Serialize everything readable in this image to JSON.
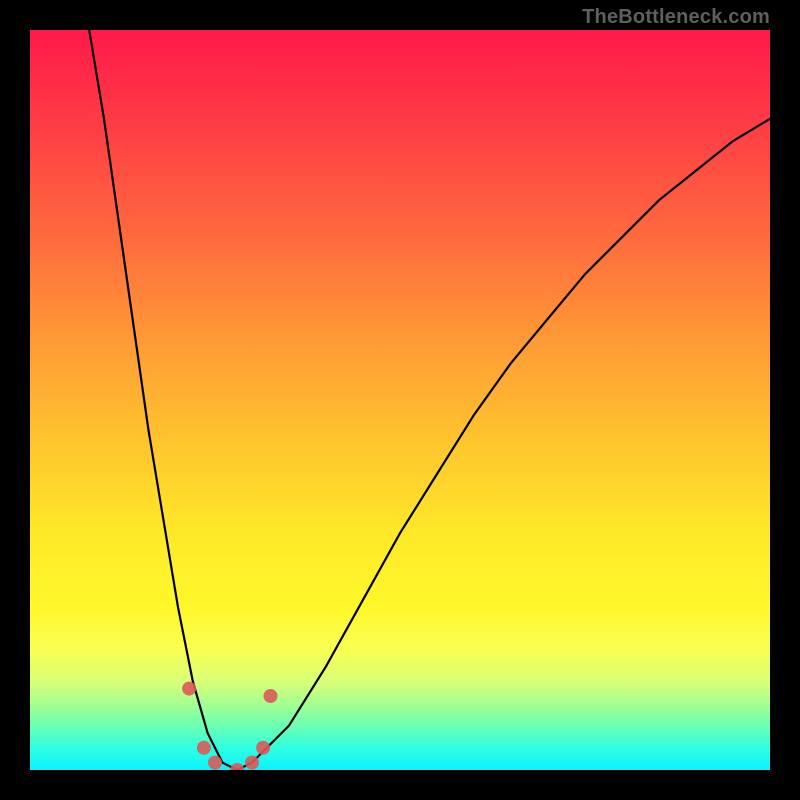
{
  "watermark": "TheBottleneck.com",
  "chart_data": {
    "type": "line",
    "title": "",
    "xlabel": "",
    "ylabel": "",
    "xlim": [
      0,
      100
    ],
    "ylim": [
      0,
      100
    ],
    "gradient_stops": [
      {
        "pos": 0,
        "color": "#ff1a4a"
      },
      {
        "pos": 50,
        "color": "#ffca30"
      },
      {
        "pos": 80,
        "color": "#fff82a"
      },
      {
        "pos": 100,
        "color": "#08f3ff"
      }
    ],
    "series": [
      {
        "name": "bottleneck-curve",
        "x": [
          8,
          10,
          12,
          14,
          16,
          18,
          20,
          22,
          24,
          26,
          28,
          30,
          35,
          40,
          45,
          50,
          55,
          60,
          65,
          70,
          75,
          80,
          85,
          90,
          95,
          100
        ],
        "y": [
          100,
          88,
          74,
          60,
          46,
          34,
          22,
          12,
          5,
          1,
          0,
          1,
          6,
          14,
          23,
          32,
          40,
          48,
          55,
          61,
          67,
          72,
          77,
          81,
          85,
          88
        ]
      }
    ],
    "markers": {
      "name": "highlight-dots",
      "points": [
        {
          "x": 21.5,
          "y": 11
        },
        {
          "x": 23.5,
          "y": 3
        },
        {
          "x": 25.0,
          "y": 1
        },
        {
          "x": 28.0,
          "y": 0
        },
        {
          "x": 30.0,
          "y": 1
        },
        {
          "x": 31.5,
          "y": 3
        },
        {
          "x": 32.5,
          "y": 10
        }
      ]
    }
  }
}
